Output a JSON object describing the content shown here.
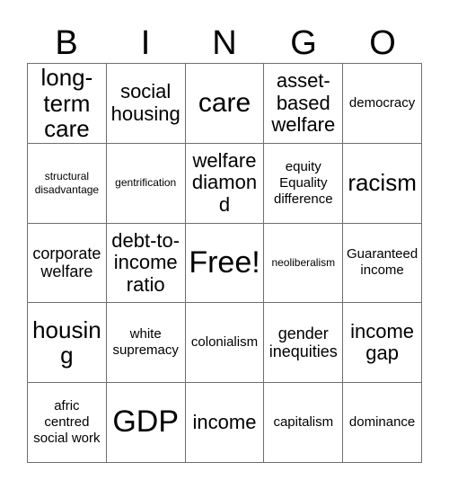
{
  "card": {
    "title": "BINGO",
    "header_letters": [
      "B",
      "I",
      "N",
      "G",
      "O"
    ],
    "free_space_label": "Free!",
    "grid_columns": 5,
    "grid_rows": 5,
    "border_color": "#6e6e6e",
    "text_color": "#000000",
    "background_color": "#ffffff",
    "cells": [
      [
        {
          "text": "long-term care",
          "size": "l",
          "free": false
        },
        {
          "text": "social housing",
          "size": "m",
          "free": false
        },
        {
          "text": "care",
          "size": "xl",
          "free": false
        },
        {
          "text": "asset-based welfare",
          "size": "m",
          "free": false
        },
        {
          "text": "democracy",
          "size": "xs",
          "free": false
        }
      ],
      [
        {
          "text": "structural disadvantage",
          "size": "xxs",
          "free": false
        },
        {
          "text": "gentrification",
          "size": "xxs",
          "free": false
        },
        {
          "text": "welfare diamond",
          "size": "m",
          "free": false
        },
        {
          "text": "equity Equality difference",
          "size": "xs",
          "free": false
        },
        {
          "text": "racism",
          "size": "l",
          "free": false
        }
      ],
      [
        {
          "text": "corporate welfare",
          "size": "s",
          "free": false
        },
        {
          "text": "debt-to-income ratio",
          "size": "m",
          "free": false
        },
        {
          "text": "Free!",
          "size": "xxl",
          "free": true
        },
        {
          "text": "neoliberalism",
          "size": "xxs",
          "free": false
        },
        {
          "text": "Guaranteed income",
          "size": "xs",
          "free": false
        }
      ],
      [
        {
          "text": "housing",
          "size": "l",
          "free": false
        },
        {
          "text": "white supremacy",
          "size": "xs",
          "free": false
        },
        {
          "text": "colonialism",
          "size": "xs",
          "free": false
        },
        {
          "text": "gender inequities",
          "size": "s",
          "free": false
        },
        {
          "text": "income gap",
          "size": "m",
          "free": false
        }
      ],
      [
        {
          "text": "afric centred social work",
          "size": "xs",
          "free": false
        },
        {
          "text": "GDP",
          "size": "xxl",
          "free": false
        },
        {
          "text": "income",
          "size": "m",
          "free": false
        },
        {
          "text": "capitalism",
          "size": "xs",
          "free": false
        },
        {
          "text": "dominance",
          "size": "xs",
          "free": false
        }
      ]
    ]
  }
}
